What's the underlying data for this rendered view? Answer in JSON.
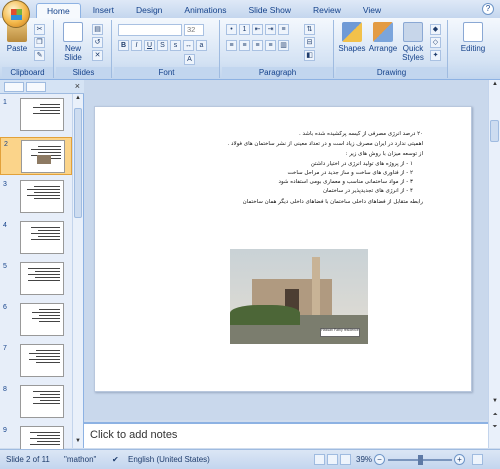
{
  "tabs": [
    "Home",
    "Insert",
    "Design",
    "Animations",
    "Slide Show",
    "Review",
    "View"
  ],
  "active_tab": "Home",
  "ribbon": {
    "clipboard": {
      "paste": "Paste",
      "group": "Clipboard"
    },
    "slides": {
      "new_slide": "New Slide",
      "group": "Slides"
    },
    "font": {
      "font_size": "32",
      "group": "Font"
    },
    "paragraph": {
      "group": "Paragraph"
    },
    "drawing": {
      "shapes": "Shapes",
      "arrange": "Arrange",
      "quick_styles": "Quick Styles",
      "group": "Drawing"
    },
    "editing": {
      "label": "Editing"
    }
  },
  "slide_numbers": [
    "1",
    "2",
    "3",
    "4",
    "5",
    "6",
    "7",
    "8",
    "9"
  ],
  "selected_slide": 2,
  "slide_content": {
    "lines": [
      "۲۰ درصد انرژی مصرفی از کیسه پرکشیده شده باشد .",
      "اهمیتی ندارد در ایران مصرف زیاد است و در تعداد معینی از نشر ساختمان های فولاد .",
      "از توسعه میزان با روش های زیر :",
      "۱ - از پروژه های تولید انرژی در اختیار داشتن",
      "۲ - از فناوری های ساخت و ساز جدید در مراحل ساخت",
      "۳ - از مواد ساختمانی مناسب و معماری بومی استفاده شود",
      "۴ - از انرژی های تجدیدپذیر در ساختمان",
      "رابطه متقابل از فضاهای داخلی ساختمان با فضاهای داخلی دیگر همان ساختمان"
    ],
    "photo_caption": "Hassan Fathy\nresidence"
  },
  "notes_placeholder": "Click to add notes",
  "status": {
    "slide_info": "Slide 2 of 11",
    "theme": "\"mathon\"",
    "language": "English (United States)",
    "zoom": "39%"
  }
}
